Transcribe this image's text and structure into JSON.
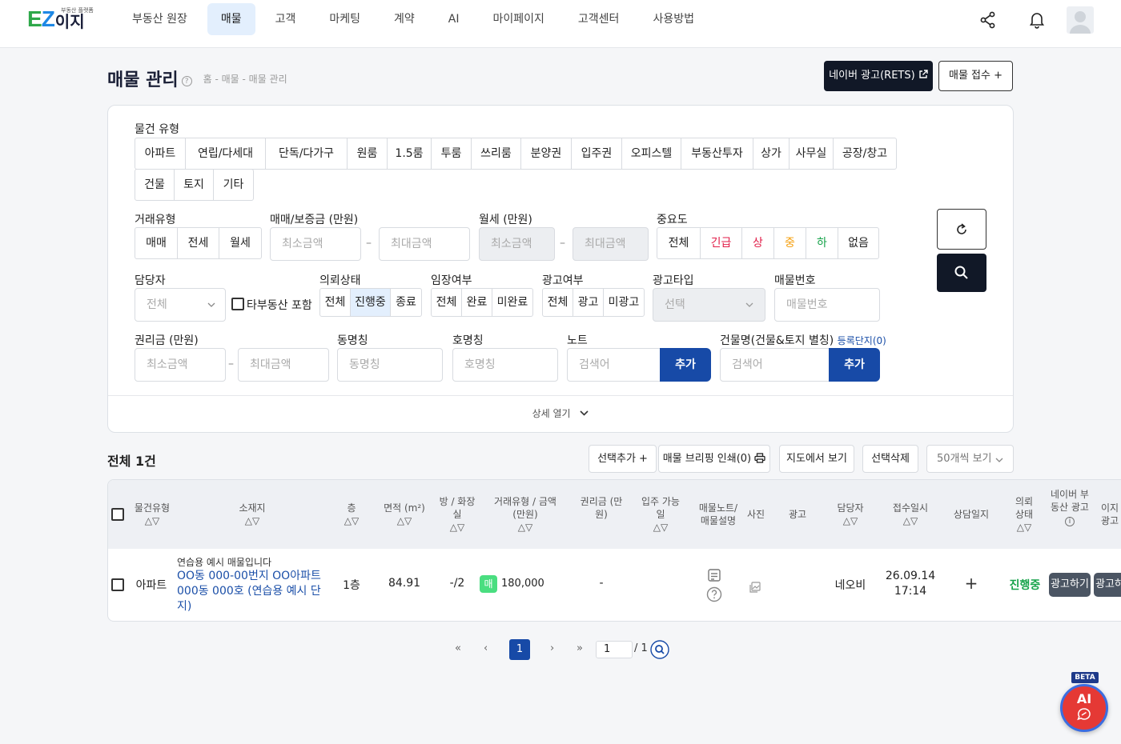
{
  "brand": {
    "tagline": "부동산 플랫폼",
    "logo_e": "E",
    "logo_z": "Z",
    "logo_name": "이지"
  },
  "nav": [
    "부동산 원장",
    "매물",
    "고객",
    "마케팅",
    "계약",
    "AI",
    "마이페이지",
    "고객센터",
    "사용방법"
  ],
  "page": {
    "title": "매물 관리",
    "help": "?",
    "breadcrumb": "홈 - 매물 - 매물 관리",
    "naver_btn": "네이버 광고(RETS)",
    "receive_btn": "매물 접수 +"
  },
  "filters": {
    "prop_type_label": "물건 유형",
    "prop_types": [
      "아파트",
      "연립/다세대",
      "단독/다가구",
      "원룸",
      "1.5룸",
      "투룸",
      "쓰리룸",
      "분양권",
      "입주권",
      "오피스텔",
      "부동산투자",
      "상가",
      "사무실",
      "공장/창고",
      "건물",
      "토지",
      "기타"
    ],
    "deal_label": "거래유형",
    "deals": [
      "매매",
      "전세",
      "월세"
    ],
    "price_label": "매매/보증금 (만원)",
    "min_ph": "최소금액",
    "max_ph": "최대금액",
    "rent_label": "월세 (만원)",
    "importance_label": "중요도",
    "importance": [
      "전체",
      "긴급",
      "상",
      "중",
      "하",
      "없음"
    ],
    "manager_label": "담당자",
    "manager_value": "전체",
    "other_agency": "타부동산 포함",
    "request_label": "의뢰상태",
    "requests": [
      "전체",
      "진행중",
      "종료"
    ],
    "vacancy_label": "임장여부",
    "vacancies": [
      "전체",
      "완료",
      "미완료"
    ],
    "ad_label": "광고여부",
    "ads": [
      "전체",
      "광고",
      "미광고"
    ],
    "adtype_label": "광고타입",
    "adtype_value": "선택",
    "propno_label": "매물번호",
    "propno_ph": "매물번호",
    "premium_label": "권리금 (만원)",
    "dong_label": "동명칭",
    "dong_ph": "동명칭",
    "ho_label": "호명칭",
    "ho_ph": "호명칭",
    "note_label": "노트",
    "search_ph": "검색어",
    "add_btn": "추가",
    "building_label": "건물명(건물&토지 별칭)",
    "registered": "등록단지(0)",
    "detail_toggle": "상세 열기"
  },
  "list": {
    "total": "전체 1건",
    "add_selected": "선택추가 +",
    "briefing": "매물 브리핑 인쇄(0)",
    "map_view": "지도에서 보기",
    "delete_selected": "선택삭제",
    "per_page": "50개씩 보기"
  },
  "columns": [
    "물건유형",
    "소재지",
    "층",
    "면적 (m²)",
    "방 / 화장실",
    "거래유형 / 금액 (만원)",
    "권리금 (만원)",
    "입주 가능일",
    "매물노트/ 매물설명",
    "사진",
    "광고",
    "담당자",
    "접수일시",
    "상담일지",
    "의뢰 상태",
    "네이버 부동산 광고",
    "이지 광고"
  ],
  "sort_mark": "△▽",
  "row": {
    "type": "아파트",
    "sample_note": "연습용 예시 매물입니다",
    "address": "OO동 000-00번지 OO아파트 000동 000호 (연습용 예시 단지)",
    "floor": "1층",
    "area": "84.91",
    "rooms": "-/2",
    "deal_badge": "매",
    "price": "180,000",
    "premium": "-",
    "manager": "네오비",
    "received_date": "26.09.14",
    "received_time": "17:14",
    "consult": "+",
    "status": "진행중",
    "naver_ad_btn": "광고하기",
    "easy_ad_btn": "광고하기"
  },
  "pagination": {
    "first": "«",
    "prev": "‹",
    "current": "1",
    "next": "›",
    "last": "»",
    "input": "1",
    "total": "/ 1"
  },
  "ai": {
    "beta": "BETA",
    "label": "AI"
  },
  "colors": {
    "primary_dark": "#111827",
    "blue": "#174aa7",
    "link": "#1b4fa8",
    "status_green": "#16a34a",
    "urgent": "#e11d48",
    "ai_red": "#e53935"
  }
}
